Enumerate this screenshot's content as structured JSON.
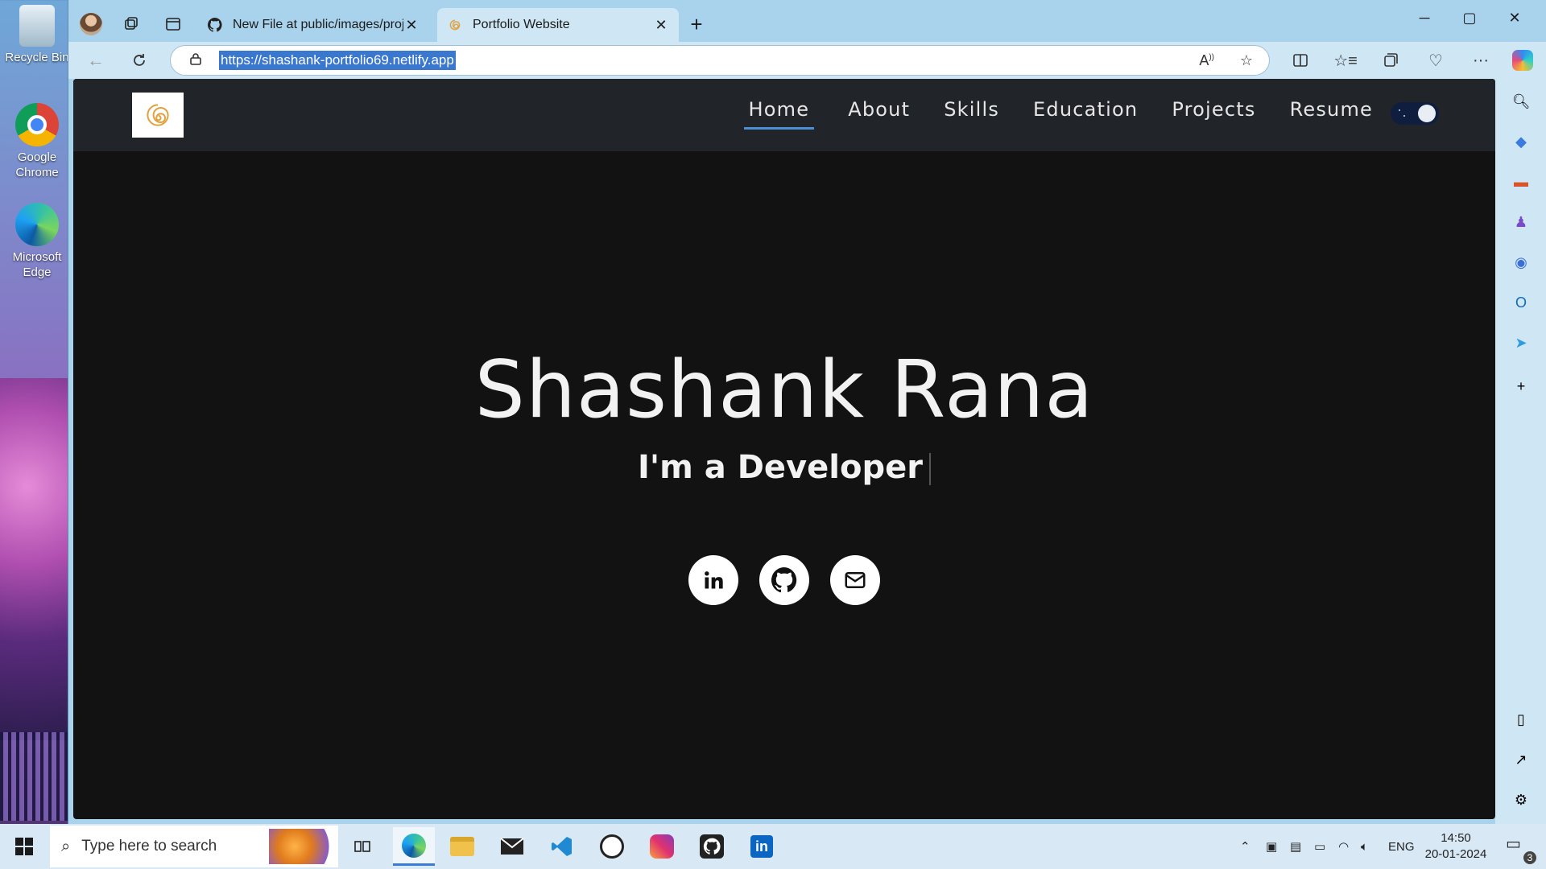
{
  "desktop": {
    "icons": [
      {
        "label": "Recycle Bin",
        "icon": "recycle-bin-icon"
      },
      {
        "label": "Google Chrome",
        "icon": "chrome-icon"
      },
      {
        "label": "Microsoft Edge",
        "icon": "edge-icon"
      }
    ]
  },
  "browser": {
    "tabs": [
      {
        "title": "New File at public/images/projec",
        "icon": "github-icon"
      },
      {
        "title": "Portfolio Website",
        "icon": "site-logo-icon"
      }
    ],
    "url": "https://shashank-portfolio69.netlify.app"
  },
  "site": {
    "nav": [
      "Home",
      "About",
      "Skills",
      "Education",
      "Projects",
      "Resume"
    ],
    "active_nav": "Home",
    "name": "Shashank Rana",
    "subtitle_prefix": "I'm a",
    "subtitle_role": "Developer",
    "socials": [
      "linkedin-icon",
      "github-icon",
      "mail-icon"
    ]
  },
  "taskbar": {
    "search_placeholder": "Type here to search",
    "language": "ENG",
    "time": "14:50",
    "date": "20-01-2024",
    "notification_count": "3"
  },
  "colors": {
    "page_bg": "#121212",
    "nav_bg": "#212428",
    "accent": "#4a8fd8",
    "chrome_bg": "#cfe6f5"
  }
}
